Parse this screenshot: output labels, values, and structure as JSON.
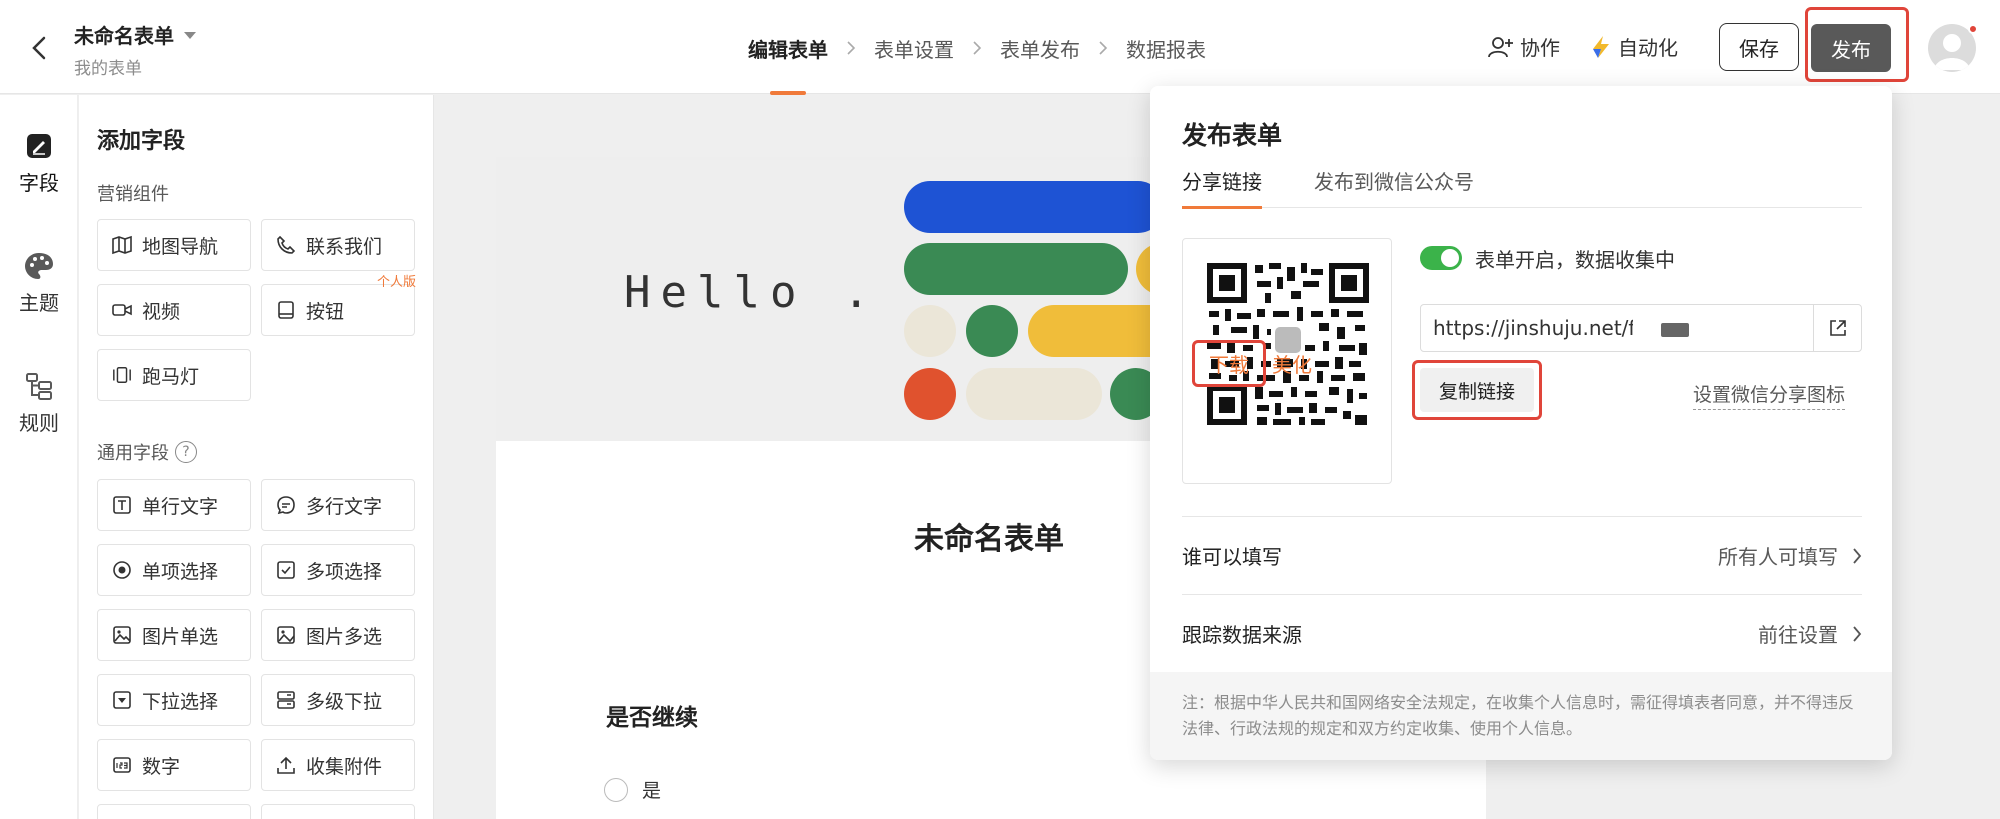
{
  "header": {
    "form_name": "未命名表单",
    "form_location": "我的表单",
    "steps": [
      "编辑表单",
      "表单设置",
      "表单发布",
      "数据报表"
    ],
    "collab_label": "协作",
    "automation_label": "自动化",
    "save_label": "保存",
    "publish_label": "发布"
  },
  "rail": {
    "items": [
      {
        "label": "字段",
        "icon": "field-icon"
      },
      {
        "label": "主题",
        "icon": "palette-icon"
      },
      {
        "label": "规则",
        "icon": "rules-icon"
      }
    ]
  },
  "panel": {
    "title": "添加字段",
    "marketing_section": "营销组件",
    "marketing_fields": [
      {
        "label": "地图导航",
        "icon": "map-icon"
      },
      {
        "label": "联系我们",
        "icon": "phone-icon"
      },
      {
        "label": "视频",
        "icon": "video-icon"
      },
      {
        "label": "按钮",
        "icon": "button-icon",
        "tag": "个人版"
      },
      {
        "label": "跑马灯",
        "icon": "marquee-icon"
      }
    ],
    "general_section": "通用字段",
    "general_help": "?",
    "general_fields": [
      {
        "label": "单行文字",
        "icon": "text-icon"
      },
      {
        "label": "多行文字",
        "icon": "multiline-icon"
      },
      {
        "label": "单项选择",
        "icon": "radio-icon"
      },
      {
        "label": "多项选择",
        "icon": "checkbox-icon"
      },
      {
        "label": "图片单选",
        "icon": "image-radio-icon"
      },
      {
        "label": "图片多选",
        "icon": "image-multi-icon"
      },
      {
        "label": "下拉选择",
        "icon": "dropdown-icon"
      },
      {
        "label": "多级下拉",
        "icon": "cascade-icon"
      },
      {
        "label": "数字",
        "icon": "number-icon"
      },
      {
        "label": "收集附件",
        "icon": "upload-icon"
      }
    ]
  },
  "canvas": {
    "banner_text": "Hello .",
    "form_title": "未命名表单",
    "question": "是否继续",
    "option": "是"
  },
  "publish_popover": {
    "title": "发布表单",
    "tabs": [
      "分享链接",
      "发布到微信公众号"
    ],
    "qr_download": "下载",
    "qr_beautify": "美化",
    "status_text": "表单开启，数据收集中",
    "status_on": true,
    "url": "https://jinshuju.net/f",
    "copy_label": "复制链接",
    "wechat_icon_label": "设置微信分享图标",
    "who_can_fill_label": "谁可以填写",
    "who_can_fill_value": "所有人可填写",
    "track_source_label": "跟踪数据来源",
    "track_source_value": "前往设置",
    "note": "注：根据中华人民共和国网络安全法规定，在收集个人信息时，需征得填表者同意，并不得违反法律、行政法规的规定和双方约定收集、使用个人信息。"
  },
  "colors": {
    "accent": "#f07a3a",
    "highlight": "#e0453a",
    "toggle_on": "#3bb34a",
    "publish_bg": "#595959"
  }
}
